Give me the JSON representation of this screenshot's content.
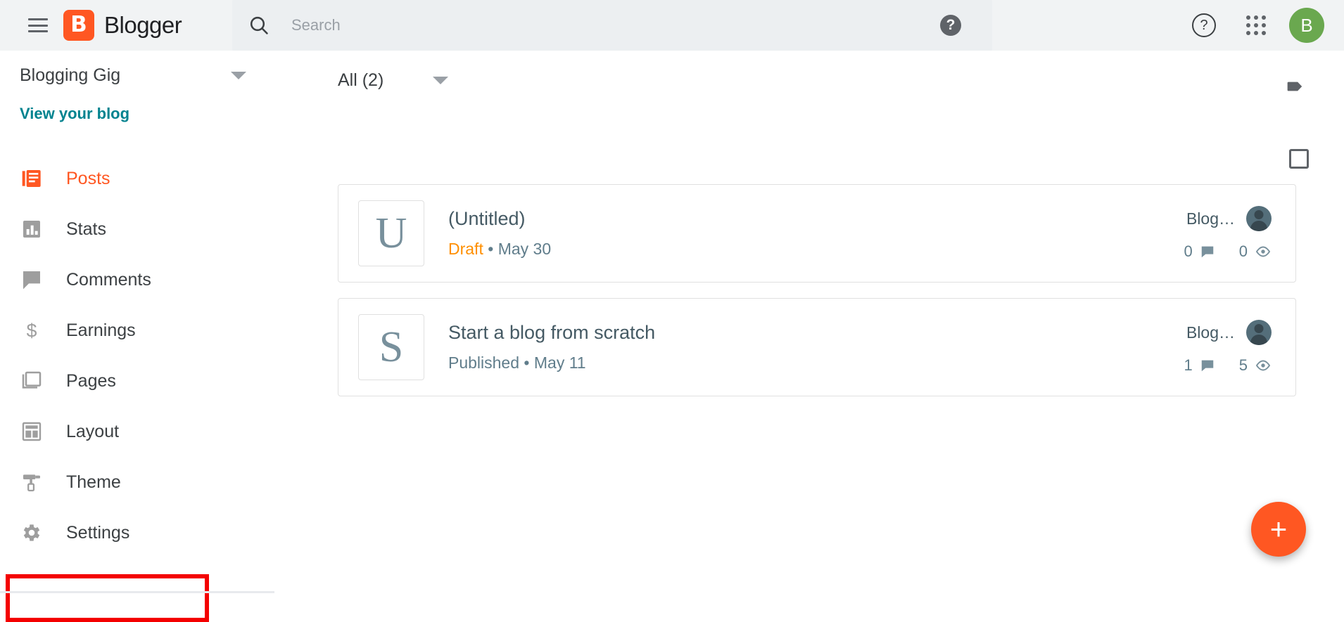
{
  "header": {
    "menu_icon": "hamburger-menu-icon",
    "brand_letter": "B",
    "brand_name": "Blogger",
    "search": {
      "icon": "search-icon",
      "placeholder": "Search",
      "value": "",
      "help_icon": "help-filled-icon",
      "help_glyph": "?"
    },
    "help_outline_glyph": "?",
    "apps_icon": "apps-grid-icon",
    "avatar_letter": "B",
    "avatar_color": "#6aa84f"
  },
  "sidebar": {
    "blog_name": "Blogging Gig",
    "blog_dropdown_icon": "chevron-down-icon",
    "view_blog_label": "View your blog",
    "view_blog_color": "#00838f",
    "active_color": "#ff5722",
    "highlight_color": "#f40000",
    "items": [
      {
        "label": "Posts",
        "icon": "posts-icon",
        "active": true
      },
      {
        "label": "Stats",
        "icon": "stats-icon",
        "active": false
      },
      {
        "label": "Comments",
        "icon": "comments-icon",
        "active": false
      },
      {
        "label": "Earnings",
        "icon": "earnings-icon",
        "active": false
      },
      {
        "label": "Pages",
        "icon": "pages-icon",
        "active": false
      },
      {
        "label": "Layout",
        "icon": "layout-icon",
        "active": false
      },
      {
        "label": "Theme",
        "icon": "theme-icon",
        "active": false
      },
      {
        "label": "Settings",
        "icon": "settings-gear-icon",
        "active": false,
        "highlighted": true
      }
    ]
  },
  "main": {
    "filter": {
      "label": "All (2)",
      "dropdown_icon": "chevron-down-icon"
    },
    "label_icon": "label-tag-icon",
    "select_all_checkbox": {
      "name": "select-all-checkbox",
      "checked": false
    },
    "posts": [
      {
        "thumb_letter": "U",
        "title": "(Untitled)",
        "status": "Draft",
        "status_color": "#ff8f00",
        "separator": "•",
        "date": "May 30",
        "author": "Blog…",
        "comments": "0",
        "views": "0"
      },
      {
        "thumb_letter": "S",
        "title": "Start a blog from scratch",
        "status": "Published",
        "status_color": "#607d8b",
        "separator": "•",
        "date": "May 11",
        "author": "Blog…",
        "comments": "1",
        "views": "5"
      }
    ],
    "fab": {
      "label": "+",
      "name": "new-post-button",
      "color": "#ff5722"
    }
  }
}
